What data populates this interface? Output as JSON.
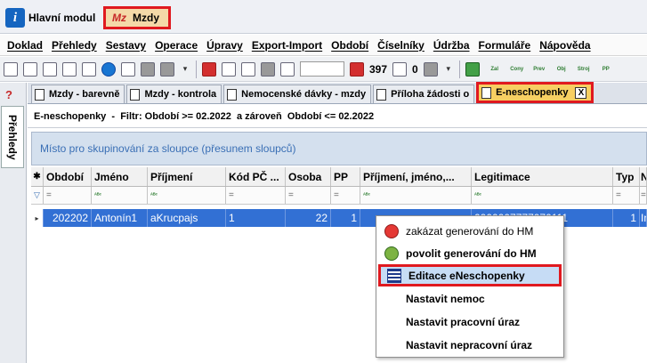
{
  "modules": {
    "hm_label": "Hlavní modul",
    "hm_icon": "i",
    "mzdy_label": "Mzdy",
    "mzdy_icon": "Mz"
  },
  "menu": [
    "Doklad",
    "Přehledy",
    "Sestavy",
    "Operace",
    "Úpravy",
    "Export-Import",
    "Období",
    "Číselníky",
    "Údržba",
    "Formuláře",
    "Nápověda"
  ],
  "toolbar": {
    "count": "397",
    "zero": "0",
    "mini": [
      "Zal",
      "Cony",
      "Prev",
      "Obj",
      "Stroj",
      "PP"
    ]
  },
  "side": {
    "help": "?",
    "prehledy": "Přehledy"
  },
  "doctabs": [
    "Mzdy - barevně",
    "Mzdy - kontrola",
    "Nemocenské dávky - mzdy",
    "Příloha žádosti o",
    "E-neschopenky"
  ],
  "close_glyph": "X",
  "filter": "E-neschopenky  -  Filtr: Období >= 02.2022  a zároveň  Období <= 02.2022",
  "group_panel": "Místo pro skupinování za sloupce (přesunem sloupců)",
  "grid": {
    "headers": [
      "Období",
      "Jméno",
      "Příjmení",
      "Kód PČ ...",
      "Osoba",
      "PP",
      "Příjmení, jméno,...",
      "Legitimace",
      "Typ",
      "N"
    ],
    "filter_eq": "=",
    "filter_txt": "ᴬᴮᶜ",
    "row": [
      "202202",
      "Antonín1",
      "aKrucpajs",
      "1",
      "22",
      "1",
      "",
      "0000007777070111",
      "1",
      "In"
    ]
  },
  "context_menu": {
    "items": [
      {
        "label": "zakázat generování do HM",
        "icon": "red-circle-icon"
      },
      {
        "label": "povolit generování do HM",
        "icon": "green-circle-icon"
      },
      {
        "label": "Editace eNeschopenky",
        "icon": "grid-icon"
      },
      {
        "label": "Nastavit nemoc",
        "icon": ""
      },
      {
        "label": "Nastavit pracovní úraz",
        "icon": ""
      },
      {
        "label": "Nastavit nepracovní úraz",
        "icon": ""
      }
    ]
  },
  "colors": {
    "highlight": "#e0191f",
    "selection": "#3270d4",
    "active_tab": "#f7cf62"
  }
}
